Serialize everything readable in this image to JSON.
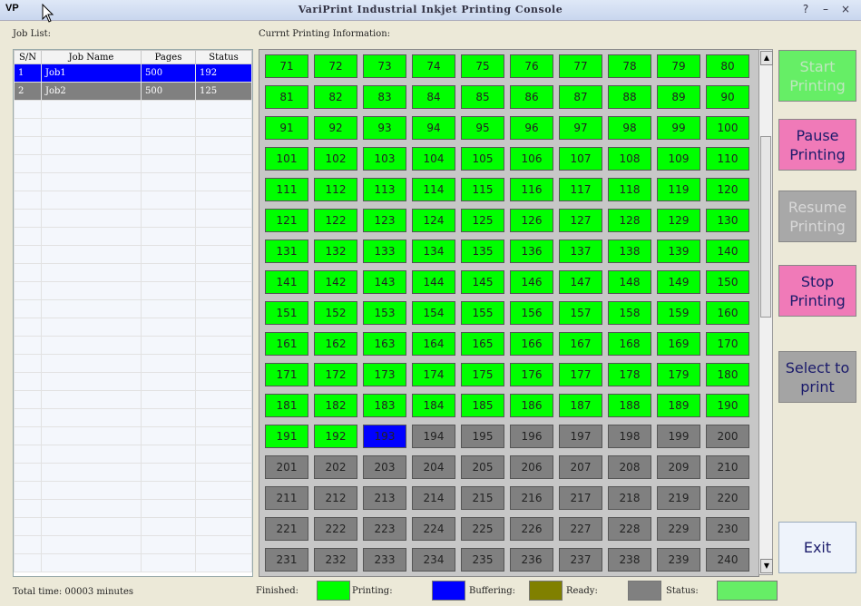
{
  "window": {
    "icon_text": "VP",
    "title": "VariPrint Industrial Inkjet Printing Console",
    "help": "?",
    "minimize": "–",
    "close": "×"
  },
  "job_list": {
    "label": "Job List:",
    "columns": [
      "S/N",
      "Job Name",
      "Pages",
      "Status"
    ],
    "rows": [
      {
        "sn": "1",
        "name": "Job1",
        "pages": "500",
        "status": "192"
      },
      {
        "sn": "2",
        "name": "Job2",
        "pages": "500",
        "status": "125"
      }
    ]
  },
  "current_info": {
    "label": "Currnt Printing Information:",
    "page_start": 71,
    "page_end": 240,
    "finished_through": 192,
    "printing_page": 193
  },
  "buttons": {
    "start": "Start Printing",
    "pause": "Pause Printing",
    "resume": "Resume Printing",
    "stop": "Stop Printing",
    "select": "Select to print",
    "exit": "Exit"
  },
  "footer": {
    "total_time": "Total time: 00003 minutes",
    "finished": "Finished:",
    "printing": "Printing:",
    "buffering": "Buffering:",
    "ready": "Ready:",
    "status": "Status:"
  },
  "colors": {
    "finished": "#00ff00",
    "printing": "#0000ff",
    "buffering": "#808000",
    "ready": "#808080",
    "status": "#66ee66"
  }
}
